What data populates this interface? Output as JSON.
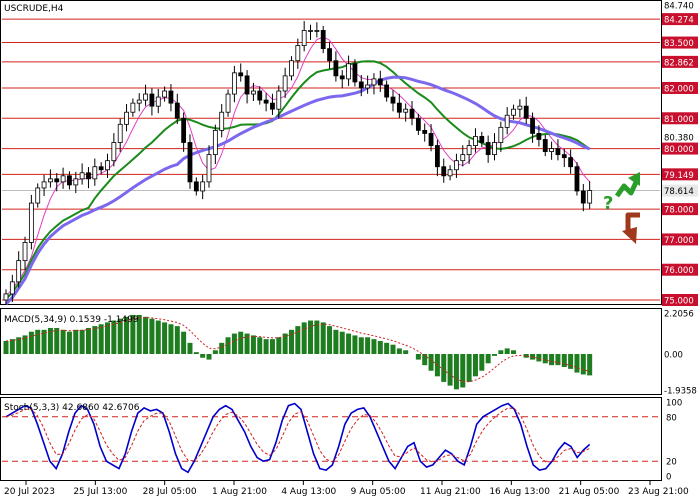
{
  "chart_data": {
    "type": "candlestick",
    "symbol_title": "USCRUDE,H4",
    "price_axis": {
      "ticks": [
        "84.740",
        "84.274",
        "83.500",
        "82.862",
        "82.000",
        "81.000",
        "80.380",
        "80.000",
        "79.149",
        "78.614",
        "78.000",
        "77.000",
        "76.000",
        "75.000"
      ],
      "hidden_ticks": [
        "83.600",
        "81.660",
        "79.700",
        "78.230"
      ],
      "ylim": [
        75.0,
        84.74
      ]
    },
    "key_levels": [
      84.274,
      83.5,
      82.862,
      82.0,
      81.0,
      80.0,
      79.149,
      78.0,
      77.0,
      76.0,
      75.0
    ],
    "current_price": 78.614,
    "x_axis_labels": [
      "20 Jul 2023",
      "25 Jul 13:00",
      "28 Jul 05:00",
      "1 Aug 21:00",
      "4 Aug 13:00",
      "9 Aug 05:00",
      "11 Aug 21:00",
      "16 Aug 13:00",
      "21 Aug 05:00",
      "23 Aug 21:00"
    ],
    "close_path": [
      75.2,
      75.6,
      76.3,
      76.9,
      78.2,
      78.7,
      78.9,
      79.0,
      78.9,
      79.1,
      78.8,
      79.0,
      79.2,
      79.0,
      79.4,
      79.3,
      79.6,
      80.2,
      80.8,
      81.2,
      81.5,
      81.6,
      81.8,
      81.4,
      81.7,
      81.9,
      81.5,
      81.0,
      80.2,
      78.9,
      78.6,
      78.9,
      79.8,
      80.6,
      81.2,
      81.8,
      82.5,
      82.4,
      81.8,
      81.9,
      81.6,
      81.5,
      81.3,
      81.9,
      82.4,
      82.9,
      83.4,
      83.9,
      83.9,
      83.9,
      83.3,
      82.9,
      82.4,
      82.3,
      82.8,
      82.2,
      82.0,
      82.1,
      82.3,
      82.1,
      81.7,
      81.5,
      81.2,
      81.3,
      81.0,
      80.6,
      80.5,
      80.1,
      79.4,
      79.1,
      79.3,
      79.6,
      79.8,
      80.1,
      80.4,
      80.2,
      79.8,
      80.2,
      80.7,
      81.1,
      81.3,
      81.4,
      81.0,
      80.5,
      80.3,
      79.9,
      80.0,
      79.8,
      79.7,
      79.4,
      78.6,
      78.2,
      78.614
    ],
    "moving_averages": [
      {
        "name": "MA-fast",
        "color": "#e040c8",
        "period": "short"
      },
      {
        "name": "MA-mid",
        "color": "#1a8a1a",
        "period": "medium"
      },
      {
        "name": "MA-slow",
        "color": "#7b68ee",
        "period": "long"
      }
    ],
    "forecast_arrows": [
      {
        "direction": "up",
        "color": "#2a9d2a"
      },
      {
        "direction": "down",
        "color": "#a0391c"
      }
    ],
    "question_mark": "?",
    "macd": {
      "label": "MACD(5,34,9) 0.1539 -1.1499",
      "ticks": [
        "2.2056",
        "0.00",
        "-1.9358"
      ],
      "ylim": [
        -1.9358,
        2.2056
      ],
      "histogram": [
        0.7,
        0.8,
        0.9,
        1.0,
        1.2,
        1.3,
        1.3,
        1.4,
        1.4,
        1.3,
        1.2,
        1.3,
        1.3,
        1.4,
        1.5,
        1.6,
        1.7,
        1.8,
        1.9,
        2.0,
        2.1,
        2.1,
        2.0,
        1.9,
        1.8,
        1.7,
        1.6,
        1.5,
        1.2,
        0.6,
        0.1,
        -0.2,
        -0.3,
        0.2,
        0.6,
        0.9,
        1.1,
        1.2,
        1.1,
        1.0,
        0.9,
        0.8,
        0.8,
        0.9,
        1.1,
        1.3,
        1.5,
        1.7,
        1.8,
        1.8,
        1.7,
        1.5,
        1.3,
        1.2,
        1.1,
        1.0,
        0.9,
        0.9,
        0.8,
        0.7,
        0.6,
        0.5,
        0.3,
        0.2,
        0.0,
        -0.3,
        -0.6,
        -0.9,
        -1.2,
        -1.5,
        -1.7,
        -1.9,
        -1.8,
        -1.5,
        -1.2,
        -0.9,
        -0.5,
        -0.1,
        0.2,
        0.3,
        0.2,
        0.0,
        -0.2,
        -0.3,
        -0.4,
        -0.5,
        -0.6,
        -0.6,
        -0.7,
        -0.8,
        -1.0,
        -1.1,
        -1.15
      ],
      "signal_color": "#d02020"
    },
    "stoch": {
      "label": "Stoch(5,3,3) 42.6860 42.6706",
      "ticks": [
        "100",
        "80",
        "20",
        "0"
      ],
      "levels": [
        80,
        20
      ],
      "main": [
        80,
        85,
        90,
        95,
        92,
        70,
        45,
        20,
        10,
        30,
        60,
        85,
        95,
        90,
        70,
        40,
        20,
        15,
        10,
        30,
        60,
        85,
        92,
        88,
        90,
        85,
        60,
        30,
        10,
        5,
        20,
        40,
        60,
        80,
        90,
        95,
        90,
        75,
        60,
        40,
        25,
        20,
        22,
        45,
        75,
        95,
        98,
        90,
        60,
        30,
        10,
        8,
        15,
        40,
        70,
        85,
        90,
        92,
        80,
        60,
        40,
        20,
        10,
        25,
        40,
        45,
        20,
        12,
        15,
        25,
        35,
        30,
        20,
        15,
        40,
        70,
        80,
        85,
        90,
        95,
        98,
        90,
        70,
        40,
        15,
        8,
        10,
        20,
        35,
        45,
        40,
        25,
        35,
        42.7
      ],
      "signal_color": "#d02020",
      "main_color": "#0000cc"
    }
  },
  "colors": {
    "level_line": "#d0231b",
    "level_label_bg": "#c8102e",
    "bull_candle": "#ffffff",
    "bear_candle": "#000000",
    "macd_bar": "#1e7d1e",
    "price_label_gray": "#e8e8e8"
  }
}
